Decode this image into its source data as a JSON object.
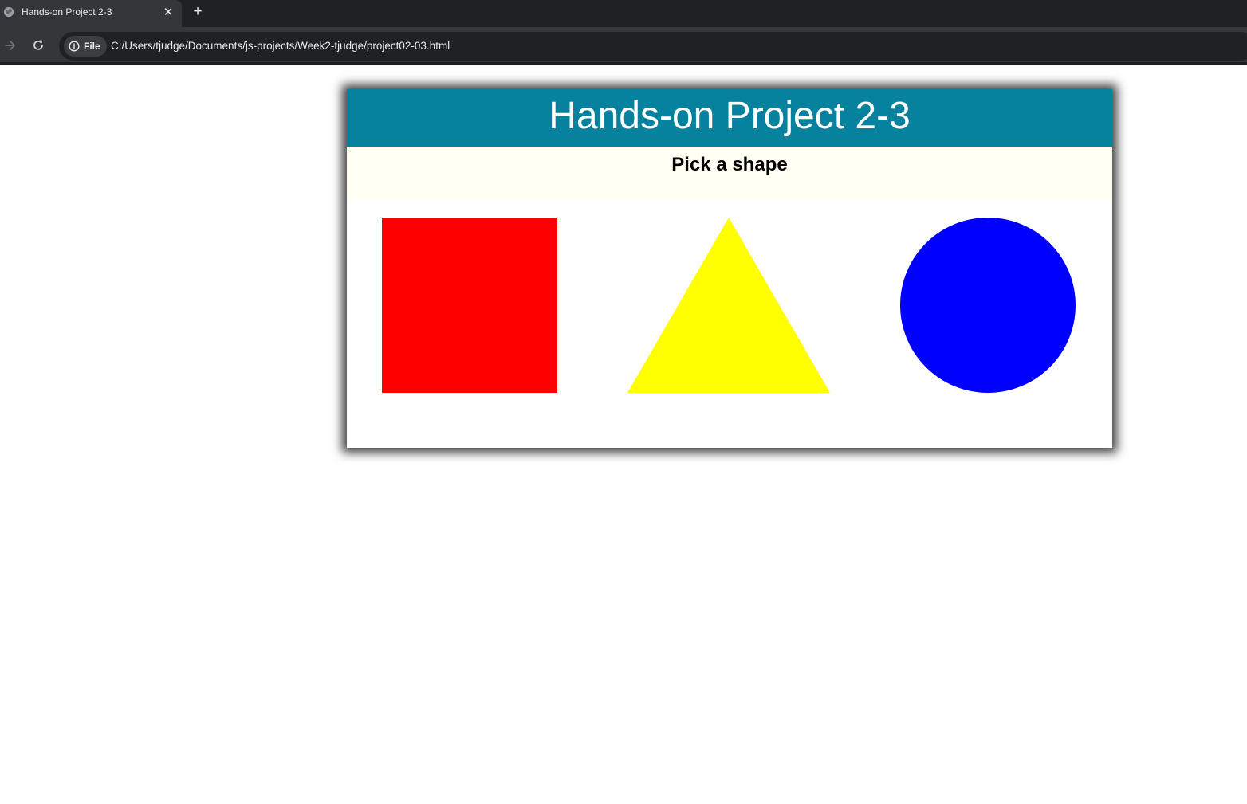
{
  "browser": {
    "tab": {
      "title": "Hands-on Project 2-3",
      "close": "✕"
    },
    "new_tab": "+",
    "address": {
      "chip": "File",
      "url": "C:/Users/tjudge/Documents/js-projects/Week2-tjudge/project02-03.html"
    }
  },
  "page": {
    "title": "Hands-on Project 2-3",
    "subtitle": "Pick a shape",
    "colors": {
      "header": "#06819e",
      "subheader": "#fffff3",
      "square": "#ff0000",
      "triangle": "#ffff00",
      "circle": "#0000ff"
    },
    "shapes": [
      {
        "name": "square",
        "color": "#ff0000"
      },
      {
        "name": "triangle",
        "color": "#ffff00"
      },
      {
        "name": "circle",
        "color": "#0000ff"
      }
    ]
  }
}
